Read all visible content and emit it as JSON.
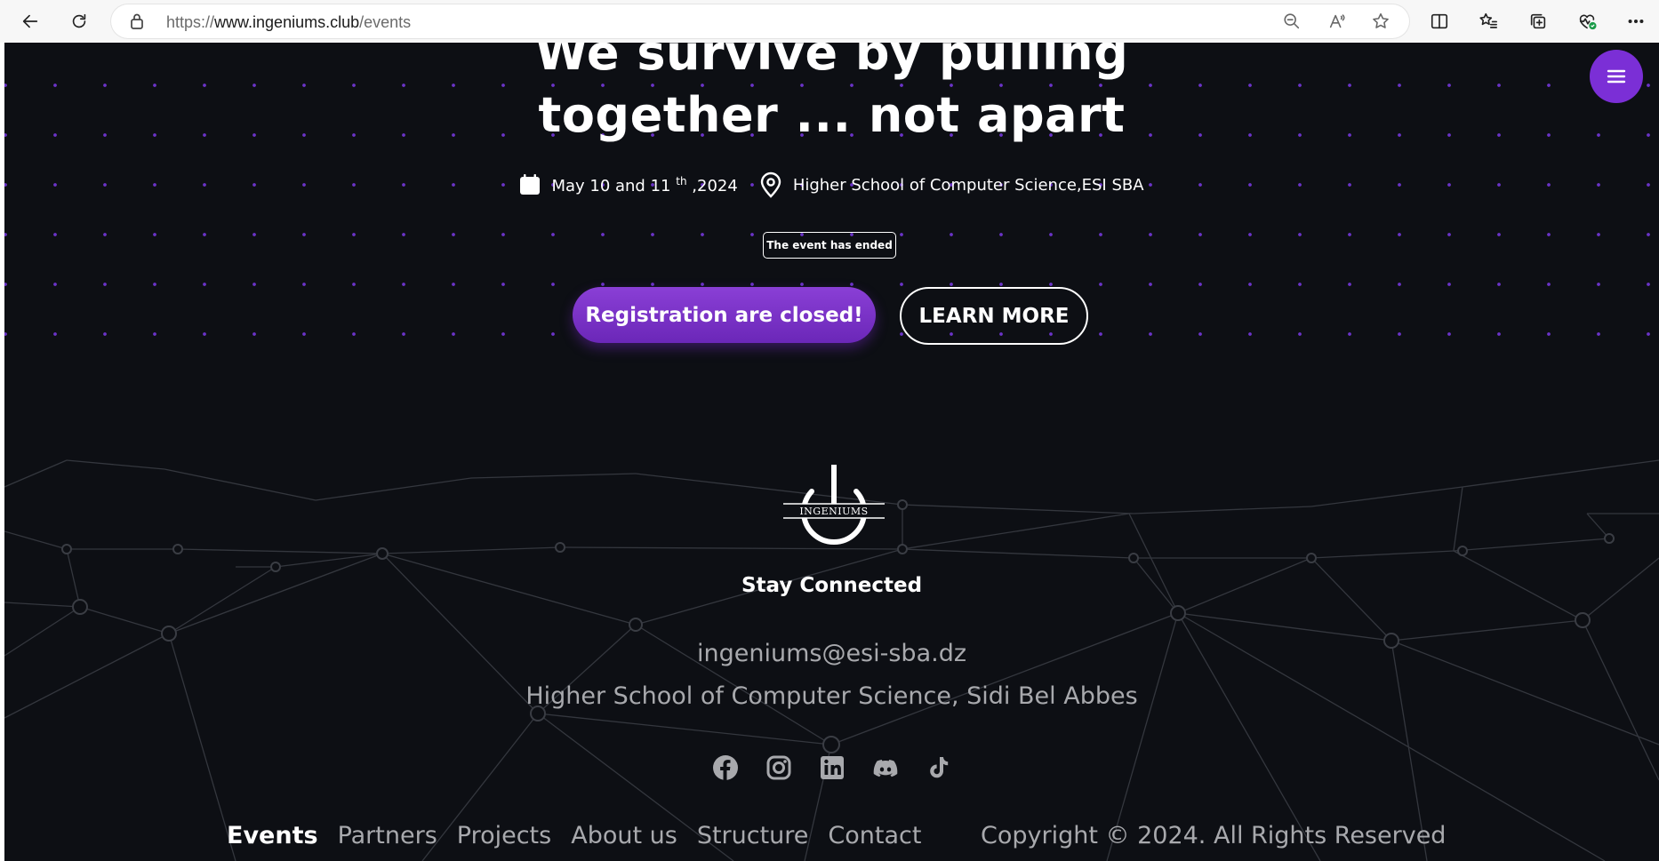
{
  "browser": {
    "url_prefix": "https://",
    "url_host": "www.ingeniums.club",
    "url_path": "/events"
  },
  "hero": {
    "heading_line1": "We survive by pulling",
    "heading_line2": "together ... not apart",
    "date_main": "May 10 and 11",
    "date_sup": "th",
    "date_year": " ,2024",
    "location": "Higher School of Computer Science,ESI SBA",
    "status_badge": "The event has ended",
    "register_button": "Registration are closed!",
    "learn_more_button": "LEARN MORE"
  },
  "footer": {
    "logo_text": "INGENIUMS",
    "stay_connected": "Stay Connected",
    "email": "ingeniums@esi-sba.dz",
    "address": "Higher School of Computer Science, Sidi Bel Abbes",
    "social": [
      "facebook-icon",
      "instagram-icon",
      "linkedin-icon",
      "discord-icon",
      "tiktok-icon"
    ],
    "nav": [
      "Events",
      "Partners",
      "Projects",
      "About us",
      "Structure",
      "Contact"
    ],
    "copyright": "Copyright © 2024. All Rights Reserved"
  },
  "colors": {
    "background": "#0d0f14",
    "accent": "#7b2fd6",
    "muted_text": "#a8a9ad"
  }
}
